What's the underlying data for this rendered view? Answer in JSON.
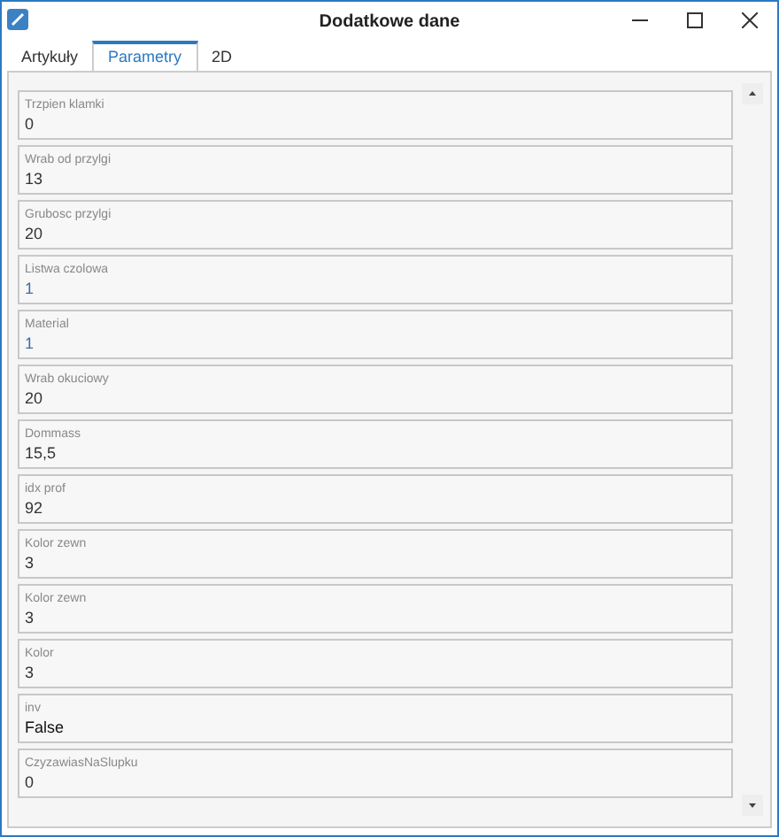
{
  "window": {
    "title": "Dodatkowe dane"
  },
  "tabs": [
    {
      "label": "Artykuły",
      "selected": false
    },
    {
      "label": "Parametry",
      "selected": true
    },
    {
      "label": "2D",
      "selected": false
    }
  ],
  "fields": [
    {
      "label": "Trzpien klamki",
      "value": "0",
      "color": "#333333"
    },
    {
      "label": "Wrab od przylgi",
      "value": "13",
      "color": "#333333"
    },
    {
      "label": "Grubosc przylgi",
      "value": "20",
      "color": "#333333"
    },
    {
      "label": "Listwa czolowa",
      "value": "1",
      "color": "#3a6ea5"
    },
    {
      "label": "Material",
      "value": "1",
      "color": "#3a6ea5"
    },
    {
      "label": "Wrab okuciowy",
      "value": "20",
      "color": "#333333"
    },
    {
      "label": "Dommass",
      "value": "15,5",
      "color": "#333333"
    },
    {
      "label": "idx prof",
      "value": "92",
      "color": "#333333"
    },
    {
      "label": "Kolor zewn",
      "value": "3",
      "color": "#333333"
    },
    {
      "label": "Kolor zewn",
      "value": "3",
      "color": "#333333"
    },
    {
      "label": "Kolor",
      "value": "3",
      "color": "#333333"
    },
    {
      "label": "inv",
      "value": "False",
      "color": "#111111"
    },
    {
      "label": "CzyzawiasNaSlupku",
      "value": "0",
      "color": "#333333"
    }
  ]
}
